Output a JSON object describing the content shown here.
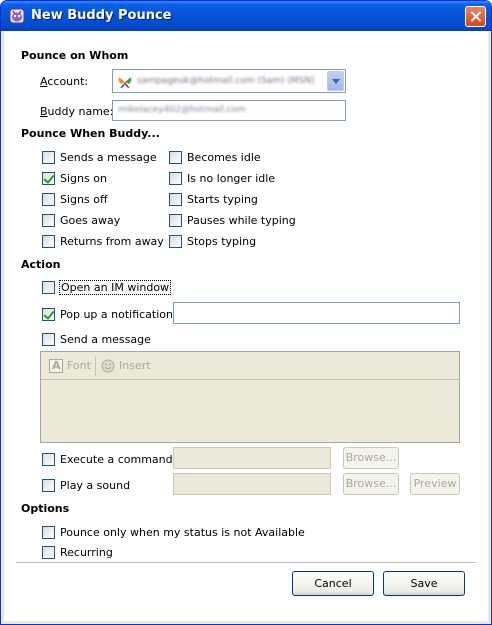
{
  "window": {
    "title": "New Buddy Pounce"
  },
  "pounce_on_whom": {
    "heading": "Pounce on Whom",
    "account_label": "Account:",
    "account_value": "sampageuk@hotmail.com (Sam) (MSN)",
    "buddy_label": "Buddy name:",
    "buddy_value": "mikelacey402@hotmail.com"
  },
  "pounce_when": {
    "heading": "Pounce When Buddy...",
    "options": [
      {
        "label": "Sends a message",
        "checked": false
      },
      {
        "label": "Signs on",
        "checked": true
      },
      {
        "label": "Signs off",
        "checked": false
      },
      {
        "label": "Goes away",
        "checked": false
      },
      {
        "label": "Returns from away",
        "checked": false
      },
      {
        "label": "Becomes idle",
        "checked": false
      },
      {
        "label": "Is no longer idle",
        "checked": false
      },
      {
        "label": "Starts typing",
        "checked": false
      },
      {
        "label": "Pauses while typing",
        "checked": false
      },
      {
        "label": "Stops typing",
        "checked": false
      }
    ]
  },
  "action": {
    "heading": "Action",
    "open_im": {
      "label": "Open an IM window",
      "checked": false
    },
    "popup": {
      "label": "Pop up a notification",
      "checked": true,
      "value": ""
    },
    "send_message": {
      "label": "Send a message",
      "checked": false
    },
    "font_label": "Font",
    "insert_label": "Insert",
    "execute": {
      "label": "Execute a command",
      "checked": false,
      "browse_label": "Browse..."
    },
    "play_sound": {
      "label": "Play a sound",
      "checked": false,
      "browse_label": "Browse...",
      "preview_label": "Preview"
    }
  },
  "options": {
    "heading": "Options",
    "only_not_available": {
      "label": "Pounce only when my status is not Available",
      "checked": false
    },
    "recurring": {
      "label": "Recurring",
      "checked": false
    }
  },
  "buttons": {
    "cancel": "Cancel",
    "save": "Save"
  },
  "colors": {
    "title_bar": "#0653d8",
    "close": "#d2451d",
    "dialog": "#ece9d8",
    "check": "#21a121"
  }
}
